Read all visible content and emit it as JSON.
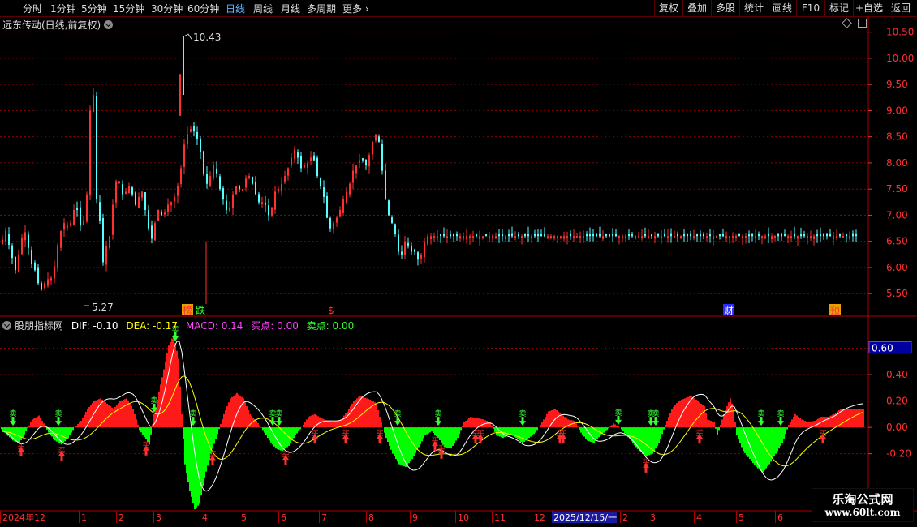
{
  "toolbar": {
    "periods": [
      "分时",
      "1分钟",
      "5分钟",
      "15分钟",
      "30分钟",
      "60分钟",
      "日线",
      "周线",
      "月线",
      "多周期",
      "更多"
    ],
    "active": "日线",
    "right_buttons": [
      "复权",
      "叠加",
      "多股",
      "统计",
      "画线",
      "F10",
      "标记",
      "+自选",
      "返回"
    ]
  },
  "main": {
    "title": "远东传动(日线,前复权)",
    "y_ticks": [
      "10.50",
      "10.00",
      "9.50",
      "9.00",
      "8.50",
      "8.00",
      "7.50",
      "7.00",
      "6.50",
      "6.00",
      "5.50"
    ],
    "high_label": "10.43",
    "low_label": "5.27",
    "markers": [
      "榜",
      "跌",
      "$",
      "财",
      "预"
    ],
    "colors": {
      "up": "#ff3030",
      "down": "#54ffff",
      "grid": "#8b0000",
      "axis": "#ff3030"
    }
  },
  "indicator": {
    "name": "股朋指标网",
    "dif_label": "DIF: -0.10",
    "dea_label": "DEA: -0.17",
    "macd_label": "MACD: 0.14",
    "buy_label": "买点: 0.00",
    "sell_label": "卖点: 0.00",
    "y_ticks": [
      "0.60",
      "0.40",
      "0.20",
      "0.00",
      "-0.20"
    ],
    "current_value": "0.60",
    "buy_text": "买",
    "sell_text": "卖",
    "colors": {
      "pos": "#ff1a1a",
      "neg": "#00ff00",
      "dif": "#ffffff",
      "dea": "#ffff00",
      "buy": "#ff3030",
      "sell": "#33ff33"
    }
  },
  "x_axis": {
    "labels": [
      "2024年12",
      "1",
      "2",
      "3",
      "4",
      "5",
      "6",
      "7",
      "8",
      "9",
      "10",
      "11",
      "12",
      "2025/12/15/一",
      "2",
      "3",
      "4",
      "5",
      "6"
    ]
  },
  "watermark": {
    "line1": "乐淘公式网",
    "line2": "www.60lt.com"
  },
  "chart_data": [
    {
      "type": "candlestick",
      "title": "远东传动(日线,前复权)",
      "ylim": [
        5.1,
        10.65
      ],
      "y_ticks": [
        10.5,
        10.0,
        9.5,
        9.0,
        8.5,
        8.0,
        7.5,
        7.0,
        6.5,
        6.0,
        5.5
      ],
      "x_labels": [
        "2024年12",
        "1",
        "2",
        "3",
        "4",
        "5",
        "6",
        "7",
        "8",
        "9",
        "10",
        "11",
        "12",
        "2025/12/15/一",
        "2",
        "3",
        "4",
        "5",
        "6"
      ],
      "annotations": [
        {
          "text": "10.43",
          "value": 10.43
        },
        {
          "text": "5.27",
          "value": 5.27
        }
      ],
      "close_anchors": [
        [
          0,
          6.45
        ],
        [
          6,
          6.7
        ],
        [
          12,
          6.3
        ],
        [
          18,
          5.95
        ],
        [
          24,
          6.4
        ],
        [
          28,
          6.75
        ],
        [
          32,
          6.6
        ],
        [
          36,
          6.15
        ],
        [
          40,
          6.0
        ],
        [
          44,
          5.9
        ],
        [
          48,
          5.5
        ],
        [
          52,
          5.65
        ],
        [
          56,
          5.75
        ],
        [
          60,
          5.8
        ],
        [
          64,
          5.8
        ],
        [
          68,
          6.25
        ],
        [
          72,
          6.6
        ],
        [
          76,
          6.8
        ],
        [
          80,
          6.9
        ],
        [
          84,
          6.7
        ],
        [
          88,
          7.0
        ],
        [
          92,
          7.2
        ],
        [
          96,
          7.0
        ],
        [
          100,
          6.6
        ],
        [
          104,
          7.2
        ],
        [
          108,
          7.6
        ],
        [
          110,
          9.0
        ],
        [
          112,
          10.2
        ],
        [
          114,
          9.3
        ],
        [
          116,
          8.2
        ],
        [
          118,
          7.3
        ],
        [
          120,
          7.0
        ],
        [
          122,
          6.9
        ],
        [
          124,
          5.8
        ],
        [
          126,
          6.1
        ],
        [
          128,
          6.5
        ],
        [
          132,
          6.3
        ],
        [
          136,
          6.9
        ],
        [
          140,
          7.5
        ],
        [
          144,
          7.8
        ],
        [
          148,
          7.5
        ],
        [
          152,
          7.3
        ],
        [
          156,
          7.6
        ],
        [
          160,
          7.5
        ],
        [
          164,
          7.3
        ],
        [
          168,
          7.1
        ],
        [
          172,
          7.6
        ],
        [
          176,
          7.3
        ],
        [
          180,
          6.9
        ],
        [
          184,
          6.6
        ],
        [
          188,
          6.5
        ],
        [
          192,
          7.2
        ],
        [
          196,
          7.0
        ],
        [
          200,
          7.0
        ],
        [
          204,
          7.1
        ],
        [
          208,
          7.3
        ],
        [
          212,
          7.2
        ],
        [
          216,
          7.5
        ],
        [
          220,
          7.6
        ],
        [
          224,
          8.2
        ],
        [
          228,
          8.5
        ],
        [
          232,
          8.6
        ],
        [
          236,
          8.7
        ],
        [
          240,
          8.5
        ],
        [
          244,
          8.4
        ],
        [
          248,
          8.0
        ],
        [
          252,
          7.6
        ],
        [
          256,
          7.6
        ],
        [
          260,
          7.9
        ],
        [
          264,
          8.0
        ],
        [
          268,
          7.6
        ],
        [
          272,
          7.4
        ],
        [
          276,
          7.2
        ],
        [
          280,
          7.0
        ],
        [
          284,
          7.3
        ],
        [
          288,
          7.5
        ],
        [
          292,
          7.6
        ],
        [
          296,
          7.4
        ],
        [
          300,
          7.6
        ],
        [
          304,
          7.8
        ],
        [
          308,
          7.7
        ],
        [
          312,
          7.5
        ],
        [
          316,
          7.3
        ],
        [
          320,
          7.2
        ],
        [
          324,
          7.3
        ],
        [
          328,
          7.1
        ],
        [
          332,
          6.9
        ],
        [
          336,
          7.4
        ],
        [
          340,
          7.5
        ],
        [
          344,
          7.5
        ],
        [
          348,
          7.7
        ],
        [
          352,
          7.8
        ],
        [
          356,
          8.0
        ],
        [
          360,
          8.2
        ],
        [
          364,
          8.3
        ],
        [
          368,
          7.9
        ],
        [
          372,
          7.9
        ],
        [
          376,
          8.0
        ],
        [
          380,
          8.0
        ],
        [
          384,
          8.2
        ],
        [
          388,
          7.9
        ],
        [
          392,
          7.6
        ],
        [
          396,
          7.5
        ],
        [
          400,
          7.2
        ],
        [
          404,
          6.7
        ],
        [
          408,
          6.8
        ],
        [
          412,
          6.9
        ],
        [
          416,
          7.0
        ],
        [
          420,
          7.2
        ],
        [
          424,
          7.4
        ],
        [
          428,
          7.5
        ],
        [
          432,
          7.7
        ],
        [
          436,
          8.0
        ],
        [
          440,
          7.9
        ],
        [
          444,
          8.2
        ],
        [
          448,
          7.9
        ],
        [
          452,
          8.0
        ],
        [
          456,
          8.3
        ],
        [
          460,
          8.5
        ],
        [
          464,
          8.6
        ],
        [
          468,
          8.2
        ],
        [
          472,
          7.5
        ],
        [
          476,
          7.1
        ],
        [
          480,
          6.9
        ],
        [
          484,
          6.8
        ],
        [
          488,
          6.5
        ],
        [
          492,
          6.1
        ],
        [
          496,
          6.4
        ],
        [
          500,
          6.6
        ],
        [
          504,
          6.2
        ],
        [
          508,
          6.4
        ],
        [
          512,
          6.2
        ],
        [
          516,
          6.1
        ],
        [
          520,
          6.4
        ],
        [
          524,
          6.6
        ]
      ]
    },
    {
      "type": "bar",
      "title": "股朋指标网",
      "ylim": [
        -0.62,
        0.72
      ],
      "y_ticks": [
        0.6,
        0.4,
        0.2,
        0.0,
        -0.2
      ],
      "series_names": [
        "DIF",
        "DEA",
        "MACD"
      ],
      "last_values": {
        "DIF": -0.1,
        "DEA": -0.17,
        "MACD": 0.14,
        "买点": 0.0,
        "卖点": 0.0
      },
      "macd_anchors": [
        [
          0,
          0
        ],
        [
          3,
          -0.04
        ],
        [
          8,
          -0.1
        ],
        [
          12,
          -0.12
        ],
        [
          16,
          -0.03
        ],
        [
          20,
          0.06
        ],
        [
          24,
          0.09
        ],
        [
          27,
          0.03
        ],
        [
          30,
          -0.04
        ],
        [
          34,
          -0.1
        ],
        [
          38,
          -0.13
        ],
        [
          42,
          -0.08
        ],
        [
          46,
          0.0
        ],
        [
          50,
          0.05
        ],
        [
          54,
          0.14
        ],
        [
          58,
          0.2
        ],
        [
          62,
          0.22
        ],
        [
          66,
          0.18
        ],
        [
          70,
          0.14
        ],
        [
          74,
          0.2
        ],
        [
          78,
          0.22
        ],
        [
          82,
          0.14
        ],
        [
          86,
          -0.02
        ],
        [
          90,
          -0.09
        ],
        [
          92,
          -0.13
        ],
        [
          95,
          0.1
        ],
        [
          100,
          0.38
        ],
        [
          104,
          0.62
        ],
        [
          107,
          0.7
        ],
        [
          110,
          0.52
        ],
        [
          112,
          0.1
        ],
        [
          114,
          -0.28
        ],
        [
          117,
          -0.48
        ],
        [
          120,
          -0.62
        ],
        [
          123,
          -0.58
        ],
        [
          126,
          -0.38
        ],
        [
          130,
          -0.2
        ],
        [
          134,
          -0.05
        ],
        [
          138,
          0.1
        ],
        [
          142,
          0.22
        ],
        [
          146,
          0.26
        ],
        [
          150,
          0.22
        ],
        [
          154,
          0.1
        ],
        [
          158,
          0.05
        ],
        [
          162,
          -0.02
        ],
        [
          166,
          -0.1
        ],
        [
          170,
          -0.16
        ],
        [
          174,
          -0.18
        ],
        [
          178,
          -0.14
        ],
        [
          182,
          -0.06
        ],
        [
          186,
          0.0
        ],
        [
          190,
          0.08
        ],
        [
          194,
          0.1
        ],
        [
          198,
          0.07
        ],
        [
          202,
          0.05
        ],
        [
          206,
          0.04
        ],
        [
          210,
          0.06
        ],
        [
          214,
          0.12
        ],
        [
          218,
          0.2
        ],
        [
          222,
          0.24
        ],
        [
          226,
          0.22
        ],
        [
          230,
          0.2
        ],
        [
          232,
          0.18
        ],
        [
          234,
          0.08
        ],
        [
          238,
          -0.08
        ],
        [
          242,
          -0.2
        ],
        [
          246,
          -0.28
        ],
        [
          250,
          -0.3
        ],
        [
          254,
          -0.24
        ],
        [
          258,
          -0.15
        ],
        [
          262,
          -0.06
        ],
        [
          266,
          -0.03
        ],
        [
          270,
          -0.08
        ],
        [
          274,
          -0.15
        ],
        [
          278,
          -0.16
        ],
        [
          282,
          -0.08
        ],
        [
          286,
          0.04
        ],
        [
          290,
          0.08
        ],
        [
          294,
          0.07
        ],
        [
          298,
          0.06
        ],
        [
          302,
          0.04
        ],
        [
          306,
          -0.06
        ],
        [
          310,
          -0.08
        ],
        [
          314,
          -0.05
        ],
        [
          318,
          -0.08
        ],
        [
          322,
          -0.12
        ],
        [
          326,
          -0.08
        ],
        [
          330,
          -0.04
        ],
        [
          334,
          0.04
        ],
        [
          338,
          0.12
        ],
        [
          342,
          0.14
        ],
        [
          346,
          0.1
        ],
        [
          350,
          0.06
        ],
        [
          354,
          0.05
        ],
        [
          358,
          -0.04
        ],
        [
          362,
          -0.1
        ],
        [
          366,
          -0.12
        ],
        [
          370,
          -0.06
        ],
        [
          374,
          -0.02
        ],
        [
          378,
          0.03
        ],
        [
          382,
          0.0
        ],
        [
          386,
          -0.06
        ],
        [
          390,
          -0.12
        ],
        [
          394,
          -0.18
        ],
        [
          398,
          -0.22
        ],
        [
          402,
          -0.2
        ],
        [
          406,
          -0.12
        ],
        [
          410,
          0.02
        ],
        [
          414,
          0.14
        ],
        [
          418,
          0.2
        ],
        [
          422,
          0.22
        ],
        [
          426,
          0.24
        ],
        [
          430,
          0.2
        ],
        [
          434,
          0.16
        ],
        [
          436,
          0.06
        ],
        [
          440,
          0.04
        ],
        [
          442,
          -0.06
        ],
        [
          446,
          0.1
        ],
        [
          450,
          0.22
        ],
        [
          452,
          0.14
        ],
        [
          454,
          -0.06
        ],
        [
          458,
          -0.18
        ],
        [
          462,
          -0.24
        ],
        [
          466,
          -0.3
        ],
        [
          470,
          -0.34
        ],
        [
          474,
          -0.28
        ],
        [
          478,
          -0.2
        ],
        [
          482,
          -0.12
        ],
        [
          486,
          0.02
        ],
        [
          490,
          0.1
        ],
        [
          494,
          0.06
        ],
        [
          498,
          0.04
        ],
        [
          502,
          0.05
        ],
        [
          506,
          0.08
        ],
        [
          510,
          0.08
        ],
        [
          514,
          0.1
        ],
        [
          518,
          0.14
        ]
      ],
      "buy_points": [
        26,
        76,
        180,
        262,
        352,
        388,
        426,
        468,
        536,
        544,
        586,
        592,
        690,
        694,
        796,
        862,
        1014
      ],
      "sell_points": [
        16,
        72,
        190,
        216,
        238,
        336,
        344,
        490,
        540,
        644,
        762,
        802,
        808,
        938,
        962
      ]
    }
  ]
}
